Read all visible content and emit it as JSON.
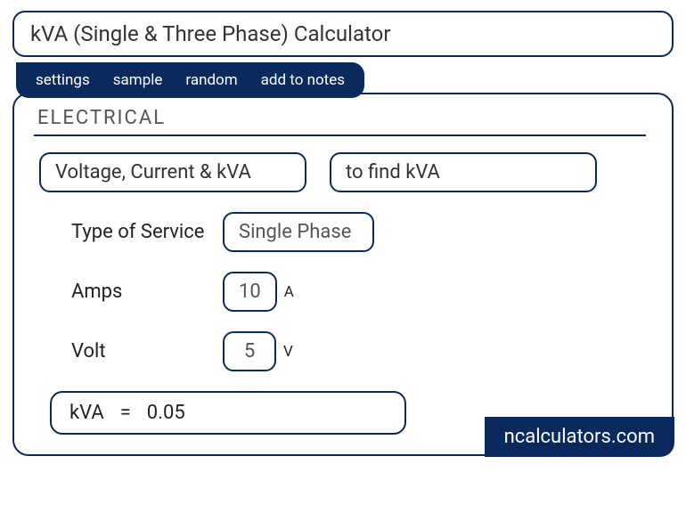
{
  "title": "kVA (Single & Three Phase) Calculator",
  "toolbar": {
    "settings": "settings",
    "sample": "sample",
    "random": "random",
    "add_to_notes": "add to notes"
  },
  "section": "ELECTRICAL",
  "selects": {
    "mode": "Voltage, Current & kVA",
    "target": "to find kVA"
  },
  "fields": {
    "service_label": "Type of Service",
    "service_value": "Single Phase",
    "amps_label": "Amps",
    "amps_value": "10",
    "amps_unit": "A",
    "volt_label": "Volt",
    "volt_value": "5",
    "volt_unit": "V"
  },
  "result": {
    "name": "kVA",
    "eq": "=",
    "value": "0.05"
  },
  "brand": "ncalculators.com"
}
